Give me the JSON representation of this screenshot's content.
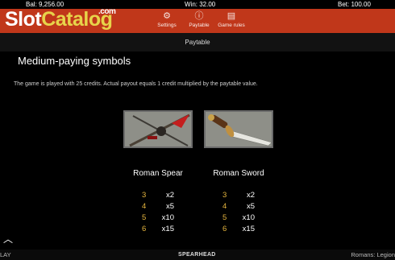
{
  "status": {
    "balance": "Bal: 9,256.00",
    "win": "Win: 32.00",
    "bet": "Bet: 100.00"
  },
  "logo": {
    "part1": "Slot",
    "part2": "Catalog",
    "suffix": ".com"
  },
  "tabs": [
    {
      "label": "Settings",
      "icon": "gear-icon"
    },
    {
      "label": "Paytable",
      "icon": "info-icon"
    },
    {
      "label": "Game rules",
      "icon": "rules-icon"
    }
  ],
  "section_title": "Paytable",
  "content": {
    "heading": "Medium-paying symbols",
    "description": "The game is played with 25 credits. Actual payout equals 1 credit multiplied by the paytable value.",
    "symbols": [
      {
        "name": "Roman Spear",
        "payouts": [
          {
            "count": "3",
            "mult": "x2"
          },
          {
            "count": "4",
            "mult": "x5"
          },
          {
            "count": "5",
            "mult": "x10"
          },
          {
            "count": "6",
            "mult": "x15"
          }
        ]
      },
      {
        "name": "Roman Sword",
        "payouts": [
          {
            "count": "3",
            "mult": "x2"
          },
          {
            "count": "4",
            "mult": "x5"
          },
          {
            "count": "5",
            "mult": "x10"
          },
          {
            "count": "6",
            "mult": "x15"
          }
        ]
      }
    ]
  },
  "bottom": {
    "play": "LAY",
    "brand": "SPEARHEAD",
    "game_title": "Romans: Legion"
  }
}
